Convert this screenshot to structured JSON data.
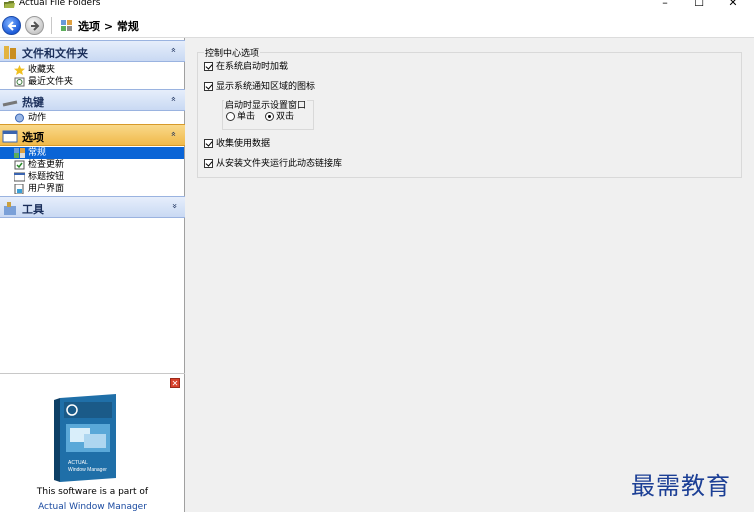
{
  "window": {
    "title": "Actual File Folders",
    "minimize": "–",
    "maximize": "☐",
    "close": "✕"
  },
  "toolbar": {
    "breadcrumb": "选项 > 常规"
  },
  "sidebar": {
    "groups": [
      {
        "label": "文件和文件夹",
        "chevron": "»",
        "items": [
          {
            "label": "收藏夹"
          },
          {
            "label": "最近文件夹"
          }
        ]
      },
      {
        "label": "热键",
        "chevron": "»",
        "items": [
          {
            "label": "动作"
          }
        ]
      },
      {
        "label": "选项",
        "chevron": "»",
        "items": [
          {
            "label": "常规"
          },
          {
            "label": "检查更新"
          },
          {
            "label": "标题按钮"
          },
          {
            "label": "用户界面"
          }
        ]
      },
      {
        "label": "工具",
        "chevron": "»",
        "items": []
      }
    ]
  },
  "ad": {
    "close": "✕",
    "text": "This software is a part of",
    "link": "Actual Window Manager",
    "box_line1": "ACTUAL",
    "box_line2": "Window Manager"
  },
  "settings": {
    "group_title": "控制中心选项",
    "start_with_system": "在系统启动时加载",
    "show_tray_icon": "显示系统通知区域的图标",
    "open_settings_on": "启动时显示设置窗口",
    "single_click": "单击",
    "double_click": "双击",
    "collect_usage": "收集使用数据",
    "run_dll": "从安装文件夹运行此动态链接库"
  },
  "watermark": "最需教育",
  "colors": {
    "accent": "#0a64d6",
    "active_group": "#f0b94a",
    "group": "#c9d9f3"
  }
}
